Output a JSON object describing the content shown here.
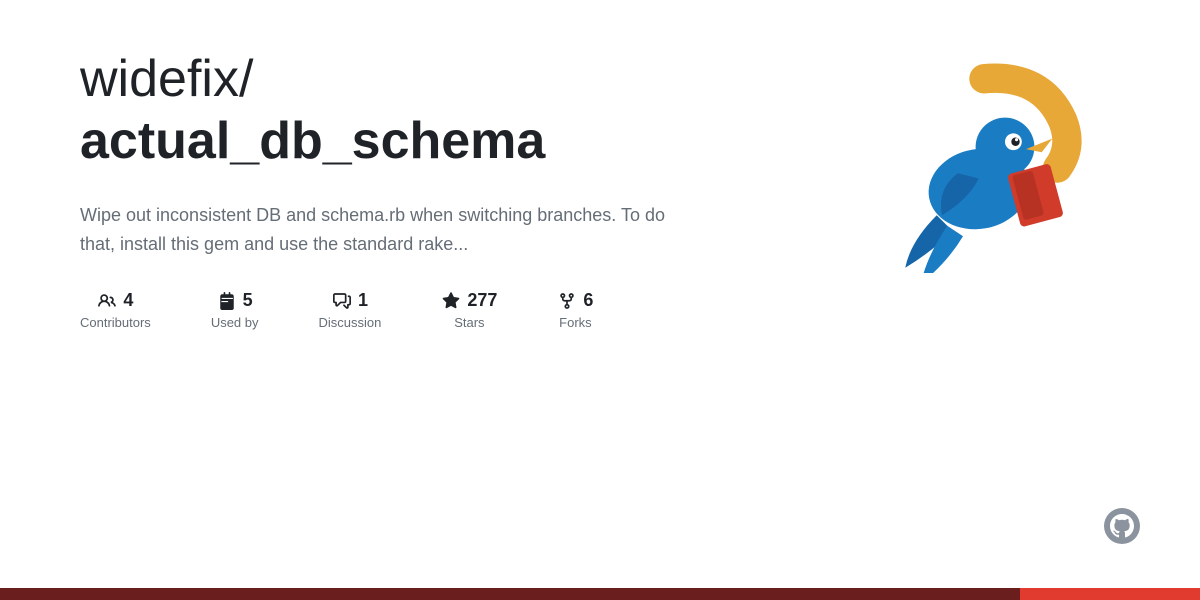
{
  "repo": {
    "owner": "widefix/",
    "name": "actual_db_schema",
    "description": "Wipe out inconsistent DB and schema.rb when switching branches. To do that, install this gem and use the standard rake..."
  },
  "stats": [
    {
      "id": "contributors",
      "number": "4",
      "label": "Contributors"
    },
    {
      "id": "used-by",
      "number": "5",
      "label": "Used by"
    },
    {
      "id": "discussion",
      "number": "1",
      "label": "Discussion"
    },
    {
      "id": "stars",
      "number": "277",
      "label": "Stars"
    },
    {
      "id": "forks",
      "number": "6",
      "label": "Forks"
    }
  ]
}
